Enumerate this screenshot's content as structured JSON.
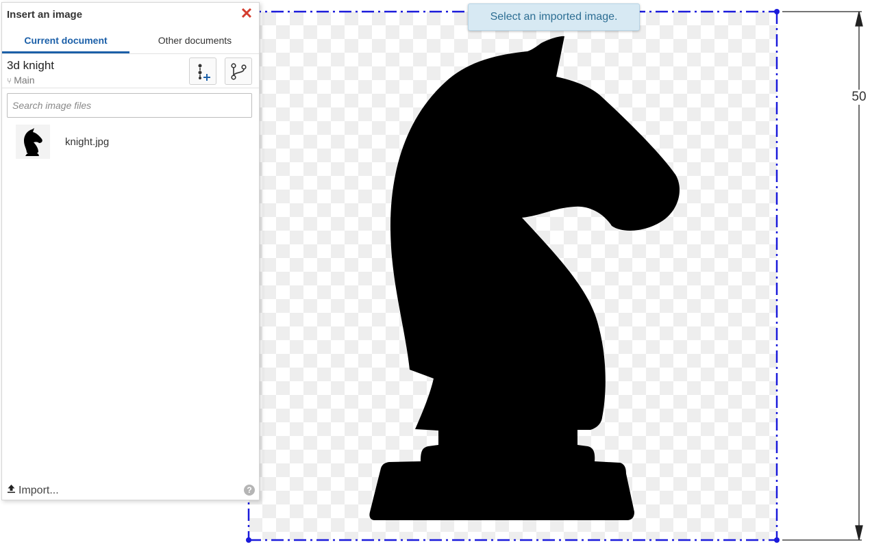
{
  "dialog": {
    "title": "Insert an image",
    "close_icon": "close-icon",
    "tabs": [
      {
        "label": "Current document",
        "active": true
      },
      {
        "label": "Other documents",
        "active": false
      }
    ],
    "document": {
      "name": "3d knight",
      "branch": "Main"
    },
    "buttons": {
      "insert_version_icon": "version-insert-icon",
      "branch_icon": "branch-icon"
    },
    "search": {
      "placeholder": "Search image files",
      "value": ""
    },
    "files": [
      {
        "name": "knight.jpg",
        "icon": "knight-thumbnail"
      }
    ],
    "import_label": "Import...",
    "help_icon": "help-icon"
  },
  "canvas": {
    "toast": "Select an imported image.",
    "dimension_value": "50",
    "selection_color": "#1a1adb"
  },
  "colors": {
    "accent": "#1b5fa8",
    "close": "#d43d2e",
    "toast_bg": "#d7e9f3",
    "toast_text": "#2d6e93"
  }
}
